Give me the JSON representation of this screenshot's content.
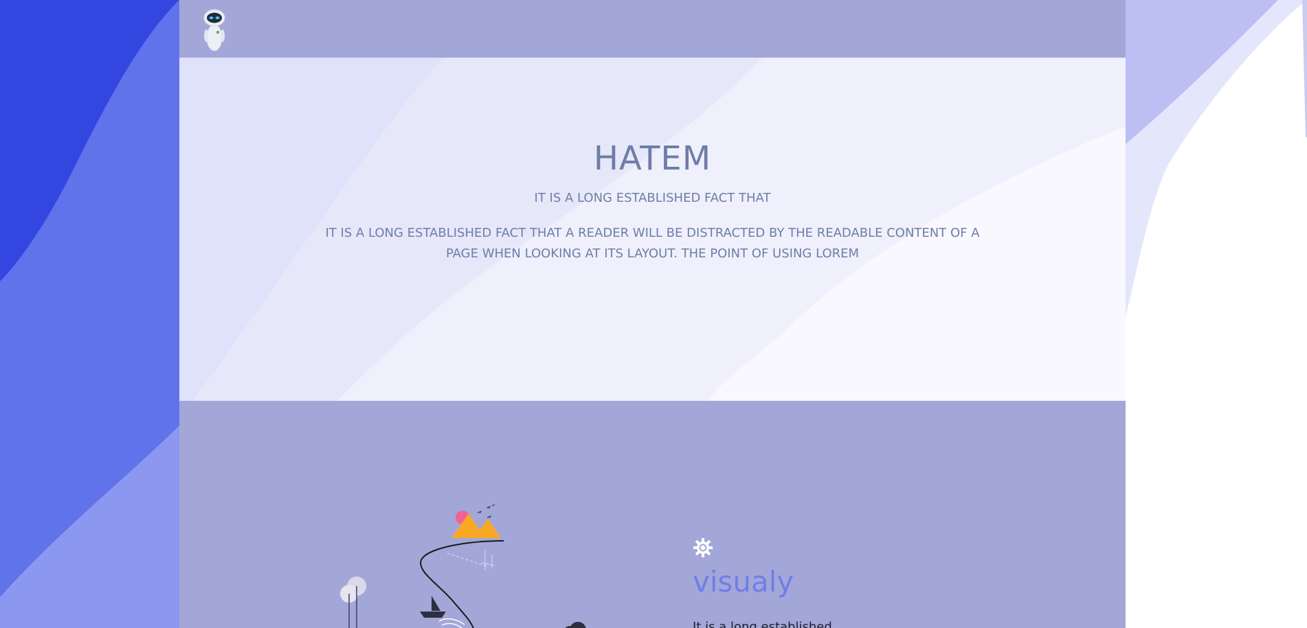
{
  "navbar": {
    "logo_icon": "robot-icon"
  },
  "hero": {
    "title": "HATEM",
    "subtitle": "IT IS A LONG ESTABLISHED FACT THAT",
    "paragraph": "IT IS A LONG ESTABLISHED FACT THAT A READER WILL BE DISTRACTED BY THE READABLE CONTENT OF A PAGE WHEN LOOKING AT ITS LAYOUT. THE POINT OF USING LOREM"
  },
  "feature": {
    "icon": "gear-icon",
    "title": "visualy",
    "text": "It is a long established"
  },
  "colors": {
    "navbar": "#a3a7d8",
    "hero_text": "#6e7da6",
    "feature_title": "#717ee8",
    "wave_dark": "#3446e0",
    "wave_mid": "#6173eb",
    "illustration_orange": "#f9a826",
    "illustration_pink": "#f06292"
  }
}
